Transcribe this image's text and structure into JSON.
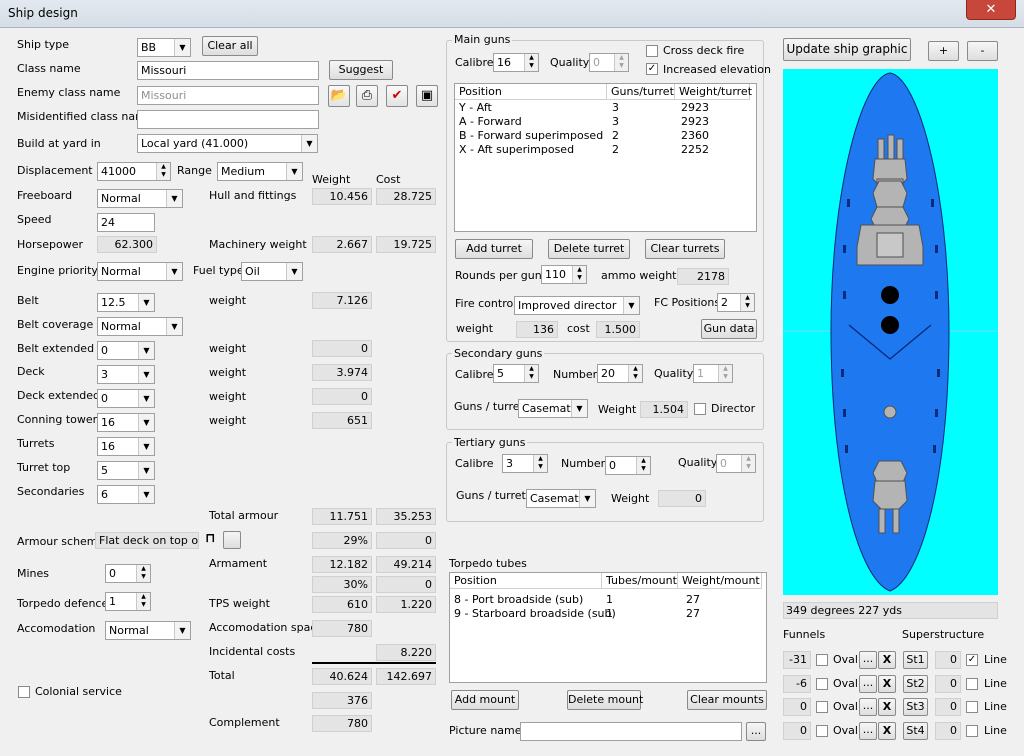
{
  "window": {
    "title": "Ship design",
    "close": "✕"
  },
  "left": {
    "ship_type_label": "Ship type",
    "ship_type": "BB",
    "clear_all": "Clear all",
    "class_name_label": "Class name",
    "class_name": "Missouri",
    "suggest": "Suggest",
    "enemy_class_label": "Enemy class name",
    "enemy_class": "Missouri",
    "misidentified_label": "Misidentified class name",
    "misidentified": "",
    "build_label": "Build at yard in",
    "build": "Local yard (41.000)",
    "displacement_label": "Displacement",
    "displacement": "41000",
    "range_label": "Range",
    "range": "Medium",
    "weight_hdr": "Weight",
    "cost_hdr": "Cost",
    "freeboard_label": "Freeboard",
    "freeboard": "Normal",
    "hull_label": "Hull and fittings",
    "hull_weight": "10.456",
    "hull_cost": "28.725",
    "speed_label": "Speed",
    "speed": "24",
    "horsepower_label": "Horsepower",
    "horsepower": "62.300",
    "machinery_label": "Machinery weight",
    "machinery_weight": "2.667",
    "machinery_cost": "19.725",
    "engine_label": "Engine priority",
    "engine": "Normal",
    "fuel_label": "Fuel type",
    "fuel": "Oil",
    "belt_label": "Belt",
    "belt": "12.5",
    "belt_w_label": "weight",
    "belt_weight": "7.126",
    "belt_cov_label": "Belt coverage",
    "belt_cov": "Normal",
    "belt_ext_label": "Belt extended",
    "belt_ext": "0",
    "belt_ext_w_label": "weight",
    "belt_ext_weight": "0",
    "deck_label": "Deck",
    "deck": "3",
    "deck_w_label": "weight",
    "deck_weight": "3.974",
    "deck_ext_label": "Deck extended",
    "deck_ext": "0",
    "deck_ext_w_label": "weight",
    "deck_ext_weight": "0",
    "conning_label": "Conning tower",
    "conning": "16",
    "conning_w_label": "weight",
    "conning_weight": "651",
    "turrets_label": "Turrets",
    "turrets": "16",
    "turret_top_label": "Turret top",
    "turret_top": "5",
    "secondaries_label": "Secondaries",
    "secondaries": "6",
    "total_armour_label": "Total armour",
    "total_armour_weight": "11.751",
    "total_armour_cost": "35.253",
    "armour_scheme_label": "Armour scheme",
    "armour_scheme": "Flat deck on top of",
    "armour_pct": "29%",
    "armour_pct_cost": "0",
    "armament_label": "Armament",
    "armament_weight": "12.182",
    "armament_cost": "49.214",
    "mines_label": "Mines",
    "mines": "0",
    "armament_pct": "30%",
    "armament_pct_cost": "0",
    "torpedo_def_label": "Torpedo defence",
    "torpedo_def": "1",
    "tps_label": "TPS weight",
    "tps_weight": "610",
    "tps_cost": "1.220",
    "accom_label": "Accomodation",
    "accom": "Normal",
    "accom_space_label": "Accomodation space",
    "accom_space": "780",
    "incidental_label": "Incidental costs",
    "incidental": "8.220",
    "total_label": "Total",
    "total_weight": "40.624",
    "total_cost": "142.697",
    "colonial_label": "Colonial service",
    "extra_value": "376",
    "complement_label": "Complement",
    "complement": "780"
  },
  "main_guns": {
    "title": "Main guns",
    "calibre_label": "Calibre",
    "calibre": "16",
    "quality_label": "Quality",
    "quality": "0",
    "cross_deck_label": "Cross deck fire",
    "cross_deck": false,
    "elevation_label": "Increased elevation",
    "elevation": true,
    "columns": [
      "Position",
      "Guns/turret",
      "Weight/turret"
    ],
    "rows": [
      [
        "Y - Aft",
        "3",
        "2923"
      ],
      [
        "A - Forward",
        "3",
        "2923"
      ],
      [
        "B - Forward superimposed",
        "2",
        "2360"
      ],
      [
        "X - Aft superimposed",
        "2",
        "2252"
      ]
    ],
    "add_turret": "Add turret",
    "delete_turret": "Delete turret",
    "clear_turrets": "Clear turrets",
    "rounds_label": "Rounds per gun",
    "rounds": "110",
    "ammo_label": "ammo weight",
    "ammo_weight": "2178",
    "fire_control_label": "Fire control",
    "fire_control": "Improved director",
    "fc_positions_label": "FC Positions",
    "fc_positions": "2",
    "fc_weight_label": "weight",
    "fc_weight": "136",
    "fc_cost_label": "cost",
    "fc_cost": "1.500",
    "gun_data": "Gun data"
  },
  "secondary": {
    "title": "Secondary guns",
    "calibre_label": "Calibre",
    "calibre": "5",
    "number_label": "Number",
    "number": "20",
    "quality_label": "Quality",
    "quality": "1",
    "guns_turret_label": "Guns / turret",
    "guns_turret": "Casemate:",
    "weight_label": "Weight",
    "weight": "1.504",
    "director_label": "Director"
  },
  "tertiary": {
    "title": "Tertiary guns",
    "calibre_label": "Calibre",
    "calibre": "3",
    "number_label": "Number",
    "number": "0",
    "quality_label": "Quality",
    "quality": "0",
    "guns_turret_label": "Guns / turret",
    "guns_turret": "Casemate:",
    "weight_label": "Weight",
    "weight": "0"
  },
  "torpedo": {
    "title": "Torpedo tubes",
    "columns": [
      "Position",
      "Tubes/mount",
      "Weight/mount"
    ],
    "rows": [
      [
        "8 - Port broadside (sub)",
        "1",
        "27"
      ],
      [
        "9 - Starboard broadside (sub)",
        "1",
        "27"
      ]
    ],
    "add_mount": "Add mount",
    "delete_mount": "Delete mount",
    "clear_mounts": "Clear mounts",
    "picture_label": "Picture name",
    "picture": "",
    "browse": "..."
  },
  "graphic": {
    "update": "Update ship graphic",
    "plus": "+",
    "minus": "-",
    "status": "349 degrees 227 yds",
    "sea_color": "#00ffff",
    "hull_color": "#1e78f0"
  },
  "funnels": {
    "title": "Funnels",
    "superstructure_title": "Superstructure",
    "oval_label": "Oval",
    "line_label": "Line",
    "dots": "...",
    "x": "X",
    "rows": [
      {
        "funnel": "-31",
        "st": "St1",
        "sval": "0",
        "line": true
      },
      {
        "funnel": "-6",
        "st": "St2",
        "sval": "0",
        "line": false
      },
      {
        "funnel": "0",
        "st": "St3",
        "sval": "0",
        "line": false
      },
      {
        "funnel": "0",
        "st": "St4",
        "sval": "0",
        "line": false
      }
    ]
  }
}
